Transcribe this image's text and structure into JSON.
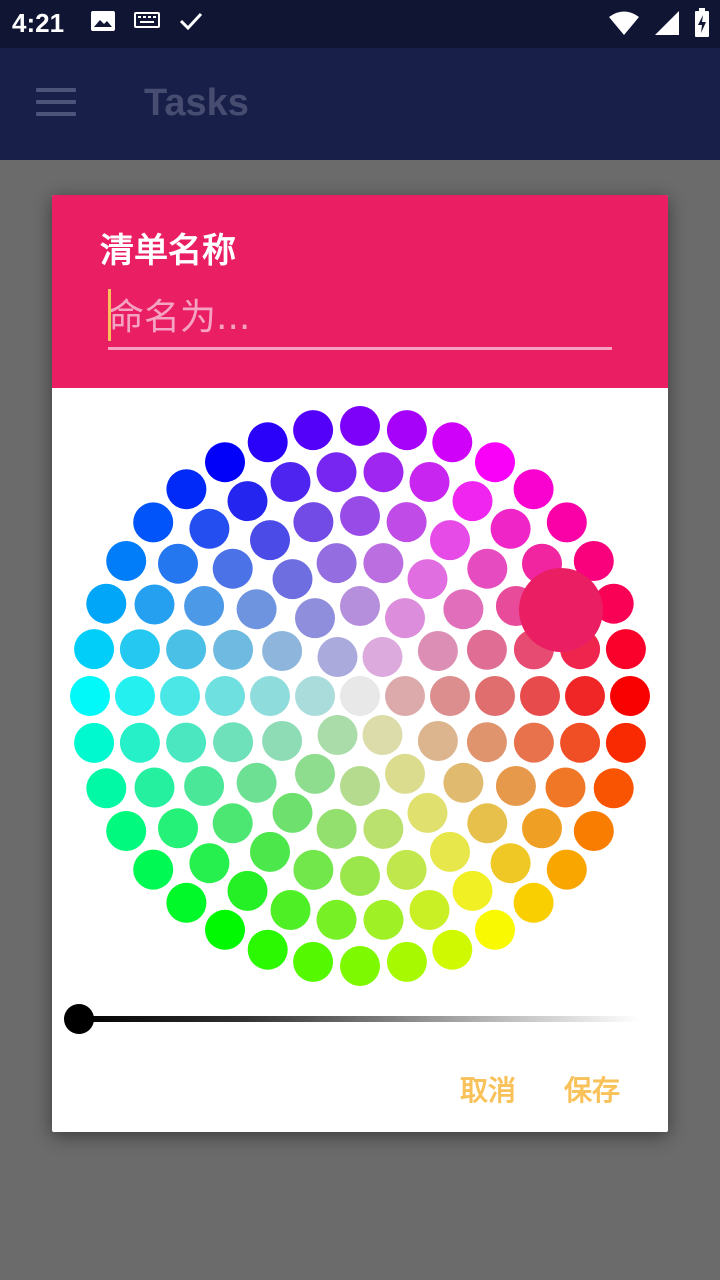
{
  "status_bar": {
    "time": "4:21",
    "left_icons": [
      "image-icon",
      "keyboard-icon",
      "check-icon"
    ],
    "right_icons": [
      "wifi-icon",
      "cell-signal-icon",
      "battery-charging-icon"
    ]
  },
  "app_bar": {
    "title": "Tasks",
    "menu_icon": "menu-icon"
  },
  "dialog": {
    "title": "清单名称",
    "name_input": {
      "value": "",
      "placeholder": "命名为..."
    },
    "header_color": "#e91e63",
    "selected_color": "#e91e63",
    "brightness_value": 0,
    "cancel_label": "取消",
    "save_label": "保存",
    "accent_color": "#f8c15a"
  }
}
